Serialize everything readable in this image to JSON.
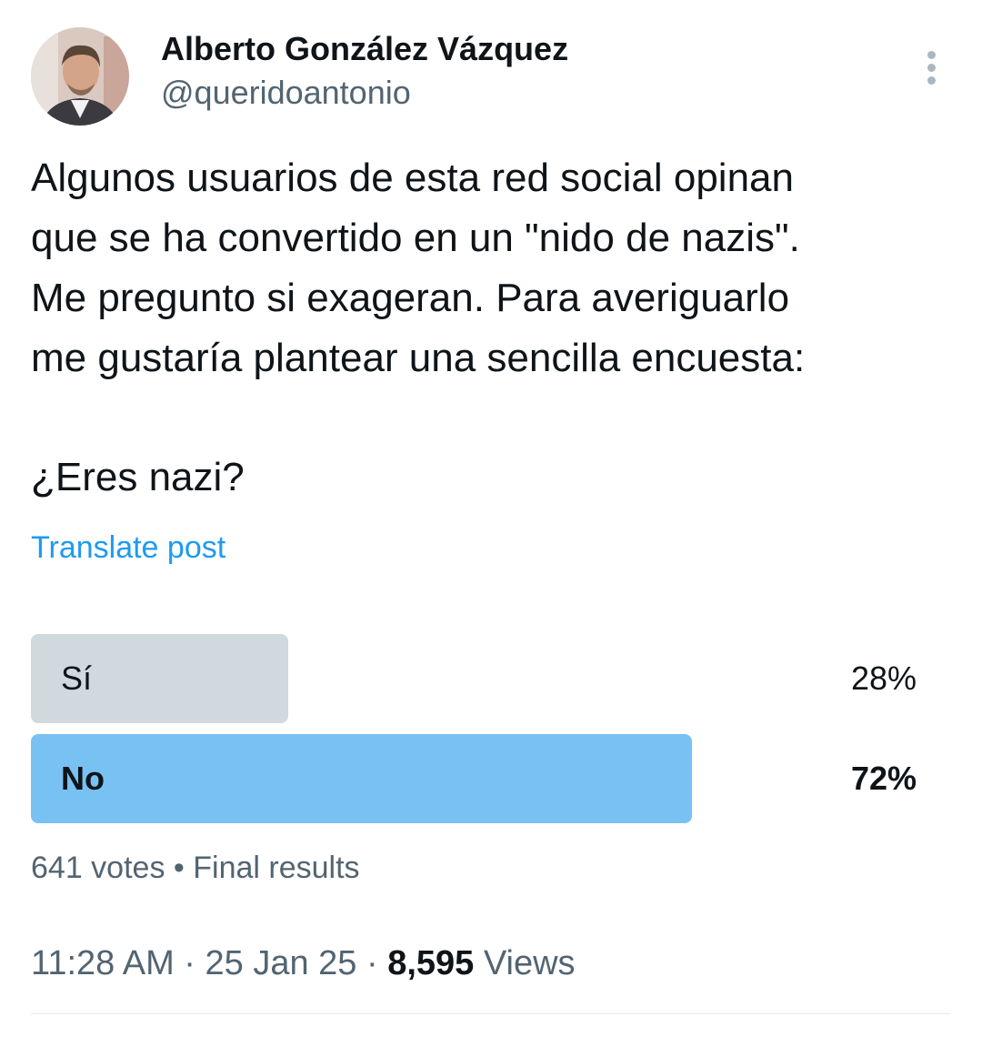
{
  "author": {
    "display_name": "Alberto González Vázquez",
    "handle": "@queridoantonio"
  },
  "tweet": {
    "text_lines": [
      "Algunos usuarios de esta red social opinan",
      "que se ha convertido en un \"nido de nazis\".",
      "Me pregunto si exageran. Para averiguarlo",
      "me gustaría plantear una sencilla encuesta:"
    ],
    "question": "¿Eres nazi?",
    "translate_label": "Translate post"
  },
  "poll": {
    "options": [
      {
        "label": "Sí",
        "percent": "28%",
        "share": 0.28,
        "winner": false,
        "bar_color": "#cfd9de"
      },
      {
        "label": "No",
        "percent": "72%",
        "share": 0.72,
        "winner": true,
        "bar_color": "#78c1f3"
      }
    ],
    "votes": "641 votes",
    "separator": "•",
    "status": "Final results"
  },
  "meta": {
    "time": "11:28 AM",
    "dot": "·",
    "date": "25 Jan 25",
    "views_count": "8,595",
    "views_label": "Views"
  },
  "icons": {
    "more": "more-vertical-icon"
  },
  "colors": {
    "link": "#1d9bf0",
    "secondary_text": "#536471",
    "primary_text": "#0f1419"
  }
}
